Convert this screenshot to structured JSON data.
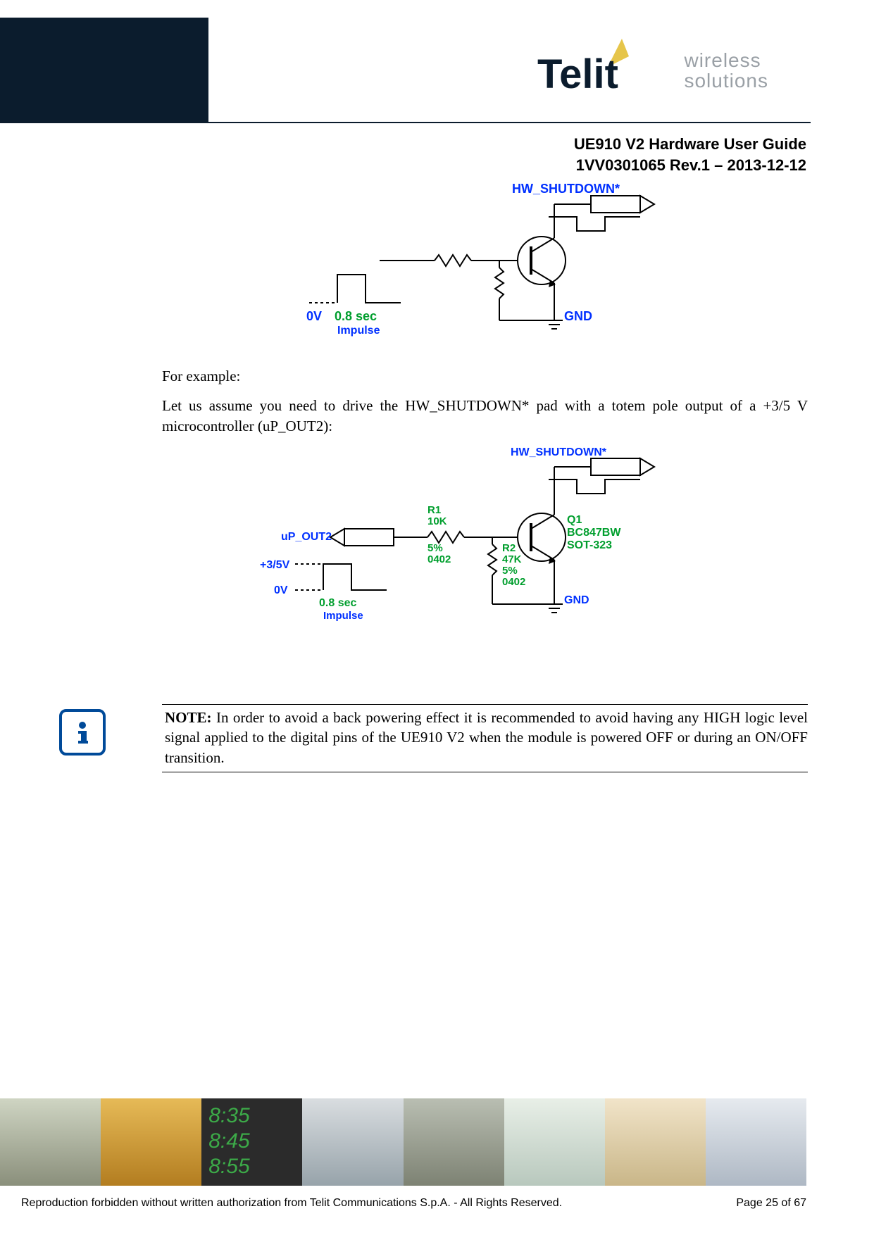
{
  "header": {
    "brand_main": "Telit",
    "brand_sub1": "wireless",
    "brand_sub2": "solutions",
    "title_line1": "UE910 V2 Hardware User Guide",
    "title_line2": "1VV0301065 Rev.1 – 2013-12-12"
  },
  "body": {
    "para1": "For example:",
    "para2": "Let us assume you need to drive the HW_SHUTDOWN* pad with a totem pole output of a +3/5 V microcontroller (uP_OUT2):"
  },
  "diagram1": {
    "hw_label": "HW_SHUTDOWN*",
    "gnd_label": "GND",
    "zero_v": "0V",
    "pulse_t": "0.8 sec",
    "pulse_sub": "Impulse"
  },
  "diagram2": {
    "hw_label": "HW_SHUTDOWN*",
    "gnd_label": "GND",
    "up_label": "uP_OUT2",
    "v_hi": "+3/5V",
    "zero_v": "0V",
    "pulse_t": "0.8 sec",
    "pulse_sub": "Impulse",
    "r1_name": "R1",
    "r1_val": "10K",
    "r1_tol": "5%",
    "r1_pkg": "0402",
    "r2_name": "R2",
    "r2_val": "47K",
    "r2_tol": "5%",
    "r2_pkg": "0402",
    "q1_name": "Q1",
    "q1_part": "BC847BW",
    "q1_pkg": "SOT-323"
  },
  "note": {
    "label": "NOTE:",
    "text": "In order to avoid a back powering effect it is recommended to avoid having any HIGH logic level signal applied to the digital pins of the UE910 V2 when the module is powered OFF or during an ON/OFF transition."
  },
  "footer": {
    "copyright": "Reproduction forbidden without written authorization from Telit Communications S.p.A. - All Rights Reserved.",
    "page": "Page 25 of 67",
    "strip_times": {
      "a": "8:35",
      "b": "8:45",
      "c": "8:55"
    }
  }
}
